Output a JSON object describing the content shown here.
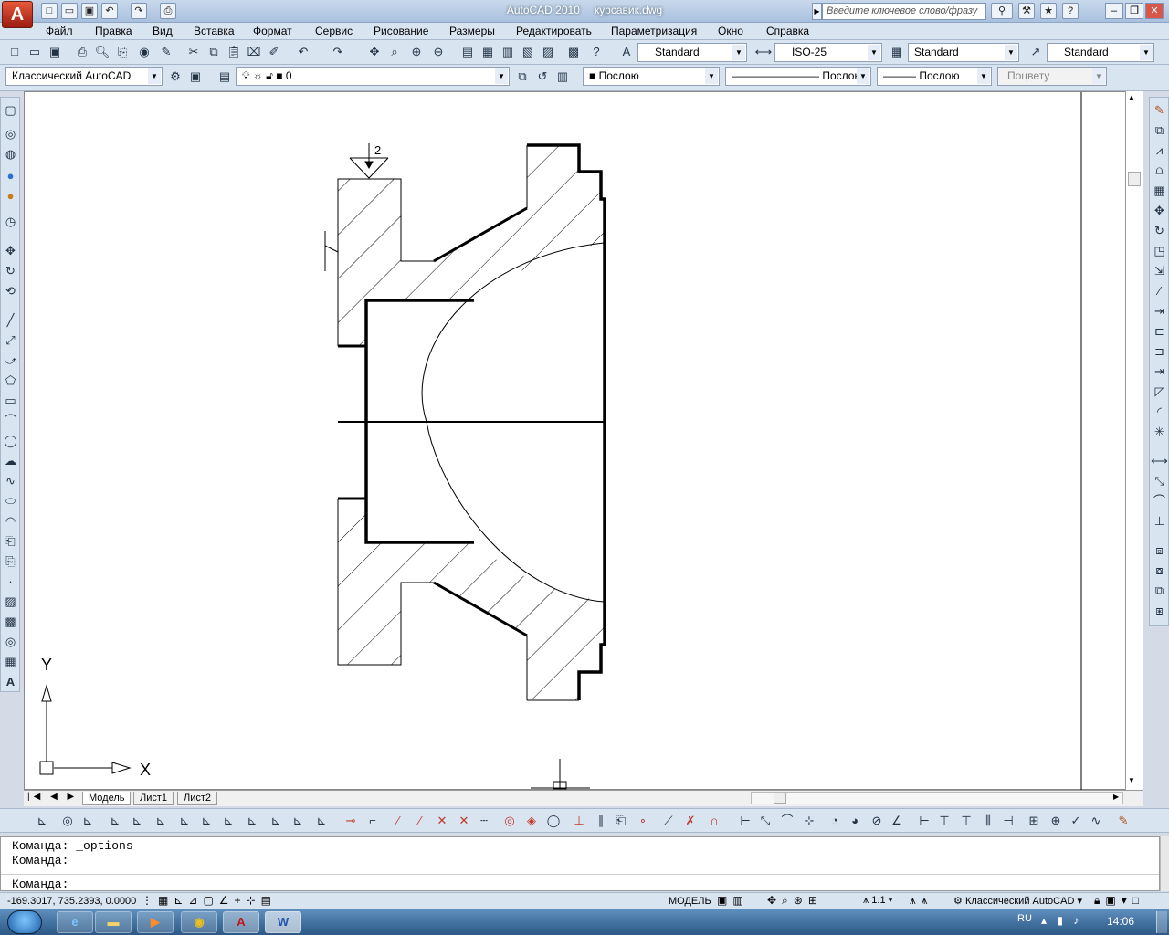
{
  "app": {
    "app_button_label": "A",
    "app_name": "AutoCAD 2010",
    "file_name": "курсавик.dwg",
    "search_placeholder": "Введите ключевое слово/фразу"
  },
  "menu": [
    "Файл",
    "Правка",
    "Вид",
    "Вставка",
    "Формат",
    "Сервис",
    "Рисование",
    "Размеры",
    "Редактировать",
    "Параметризация",
    "Окно",
    "Справка"
  ],
  "toolbar_styles": {
    "text_style": "Standard",
    "dim_style": "ISO-25",
    "table_style": "Standard",
    "multileader_style": "Standard"
  },
  "toolbar_layers": {
    "workspace": "Классический AutoCAD",
    "layer": "0",
    "color": "Послою",
    "linetype": "Послою",
    "lineweight": "Послою",
    "plotstyle": "Поцвету"
  },
  "drawing": {
    "surface_mark": "2",
    "ucs_y": "Y",
    "ucs_x": "X"
  },
  "tabs": [
    "Модель",
    "Лист1",
    "Лист2"
  ],
  "command": {
    "history": [
      "Команда:  _options",
      "Команда:"
    ],
    "prompt": "Команда:"
  },
  "status": {
    "coords": "-169.3017, 735.2393, 0.0000",
    "model_label": "МОДЕЛЬ",
    "scale": "1:1",
    "workspace": "Классический AutoCAD"
  },
  "taskbar": {
    "lang": "RU",
    "time": "14:06",
    "autocad_icon_label": "A",
    "word_icon_label": "W"
  }
}
